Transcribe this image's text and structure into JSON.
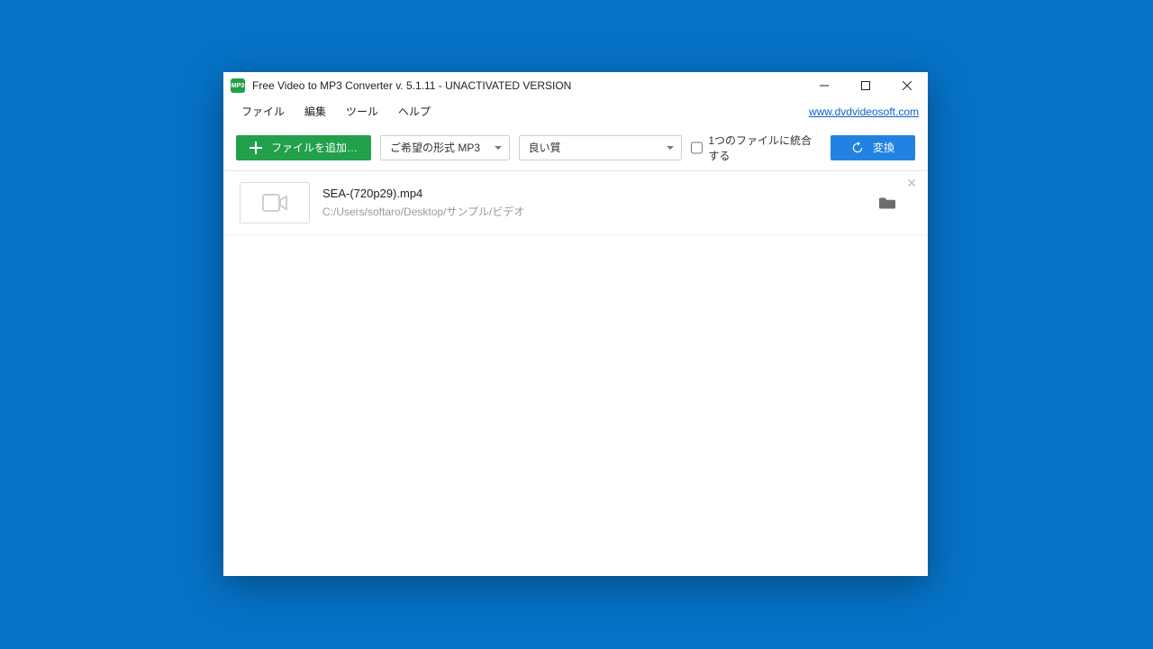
{
  "window": {
    "title": "Free Video to MP3 Converter v. 5.1.11 - UNACTIVATED VERSION"
  },
  "menu": {
    "file": "ファイル",
    "edit": "編集",
    "tools": "ツール",
    "help": "ヘルプ",
    "site_link": "www.dvdvideosoft.com"
  },
  "toolbar": {
    "add_file_label": "ファイルを追加…",
    "format_label": "ご希望の形式 MP3",
    "quality_label": "良い質",
    "merge_label": "1つのファイルに統合する",
    "convert_label": "変換"
  },
  "files": [
    {
      "name": "SEA-(720p29).mp4",
      "path": "C:/Users/softaro/Desktop/サンプル/ビデオ"
    }
  ]
}
